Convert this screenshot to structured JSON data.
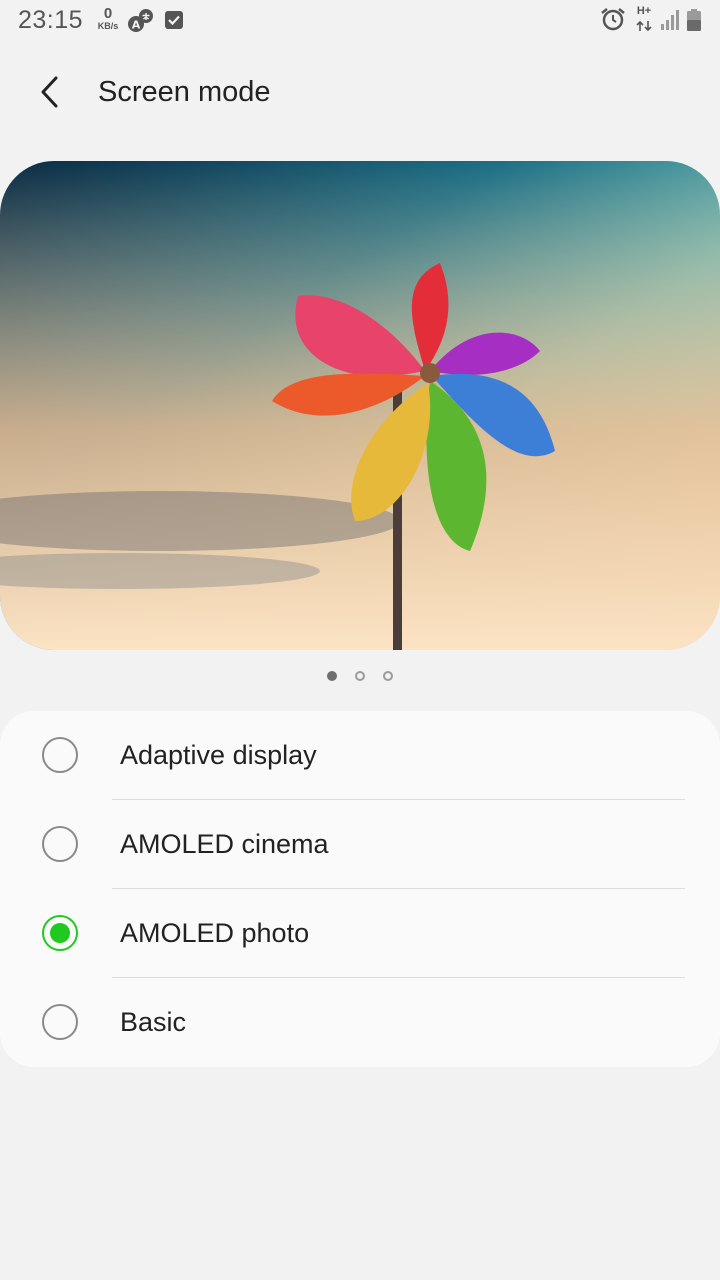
{
  "status_bar": {
    "time": "23:15",
    "data_speed_value": "0",
    "data_speed_unit": "KB/s",
    "network_type": "H+",
    "icons": [
      "translate-icon",
      "checkbox-notification-icon",
      "alarm-icon",
      "network-arrows-icon",
      "signal-icon",
      "battery-icon"
    ]
  },
  "header": {
    "title": "Screen mode",
    "back_icon": "chevron-left-icon"
  },
  "preview": {
    "image": "pinwheel-sky-photo",
    "page_count": 3,
    "active_page": 1
  },
  "options": [
    {
      "label": "Adaptive display",
      "selected": false
    },
    {
      "label": "AMOLED cinema",
      "selected": false
    },
    {
      "label": "AMOLED photo",
      "selected": true
    },
    {
      "label": "Basic",
      "selected": false
    }
  ],
  "colors": {
    "accent": "#1fc91f",
    "background": "#f2f2f2",
    "card": "#fafafa"
  }
}
